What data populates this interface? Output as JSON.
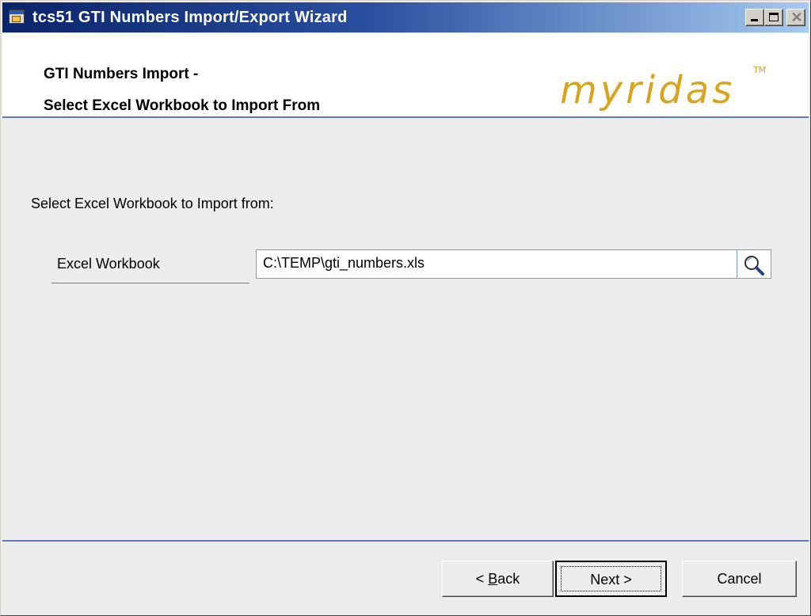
{
  "window": {
    "title": "tcs51 GTI Numbers Import/Export Wizard"
  },
  "header": {
    "title_line1": "GTI Numbers Import -",
    "title_line2": "Select Excel Workbook to Import From",
    "logo": "myridas",
    "logo_tm": "TM",
    "logo_color": "#d9a520"
  },
  "content": {
    "intro": "Select Excel Workbook to Import from:",
    "field_label": "Excel Workbook",
    "field_value": "C:\\TEMP\\gti_numbers.xls",
    "browse_icon": "magnifier-icon"
  },
  "buttons": {
    "back_prefix": "< ",
    "back_mnemonic": "B",
    "back_rest": "ack",
    "next": "Next >",
    "cancel": "Cancel"
  },
  "colors": {
    "titlebar_start": "#0a246a",
    "titlebar_end": "#a6caf0",
    "accent_line": "#5b7fb3",
    "panel_bg": "#ececec"
  }
}
